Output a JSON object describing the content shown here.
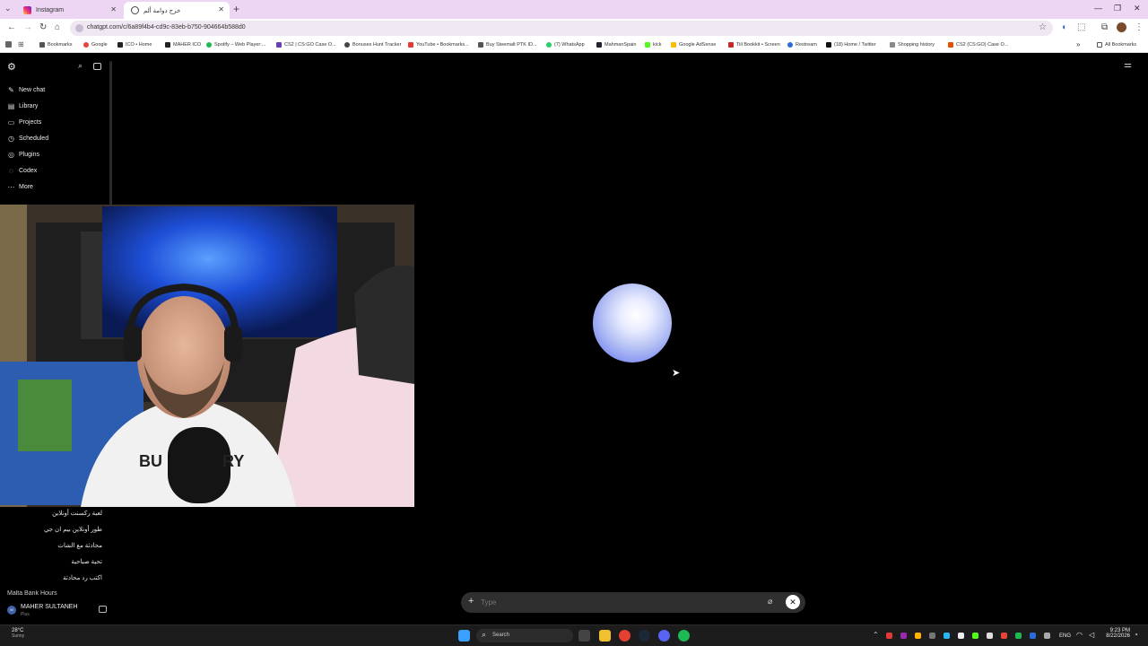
{
  "browser": {
    "tabs": [
      {
        "title": "Instagram"
      },
      {
        "title": "خرج دوامة ألم"
      }
    ],
    "url": "chatgpt.com/c/6a89f4b4-cd9c-83eb-b750-904664b588d0",
    "bookmarks": [
      "Bookmarks",
      "Google",
      "ICO • Home",
      "MAHER ICO",
      "Spotify – Web Player:...",
      "CS2 | CS:GO Case O...",
      "Bonuses Hunt Tracker",
      "YouTube • Bookmarks...",
      "Buy Steemalt PTK ID...",
      "(7) WhatsApp",
      "MahmanSpain",
      "kick",
      "Google AdSense",
      "Tiil Bookkit • Screen",
      "Restream",
      "(18) Home / Twitter",
      "Shopping history",
      "CS2 (CS:GO) Case O..."
    ],
    "all_bookmarks": "All Bookmarks"
  },
  "sidebar": {
    "nav": [
      {
        "label": "New chat",
        "icon": "new-chat-icon"
      },
      {
        "label": "Library",
        "icon": "library-icon"
      },
      {
        "label": "Projects",
        "icon": "folder-icon"
      },
      {
        "label": "Scheduled",
        "icon": "clock-icon"
      },
      {
        "label": "Plugins",
        "icon": "plugin-icon"
      },
      {
        "label": "Codex",
        "icon": "codex-icon"
      },
      {
        "label": "More",
        "icon": "more-icon"
      }
    ],
    "chats": [
      "لعبة ركسنت أونلاين",
      "طور أونلاين بيم ان جي",
      "محادثة مع الشات",
      "تحية صباحية",
      "اكتب رد محادثة",
      "Malta Bank Hours"
    ],
    "user": {
      "name": "MAHER SULTANEH",
      "plan": "Plus",
      "initials": "M"
    }
  },
  "composer": {
    "placeholder": "Type"
  },
  "taskbar": {
    "weather_temp": "28°C",
    "weather_desc": "Sunny",
    "search": "Search",
    "language": "ENG",
    "time": "9:23 PM",
    "date": "8/22/2026"
  },
  "colors": {
    "tabstrip": "#ecd6f3",
    "orb": "#7d8ef0",
    "composer": "#2f2f2f"
  }
}
